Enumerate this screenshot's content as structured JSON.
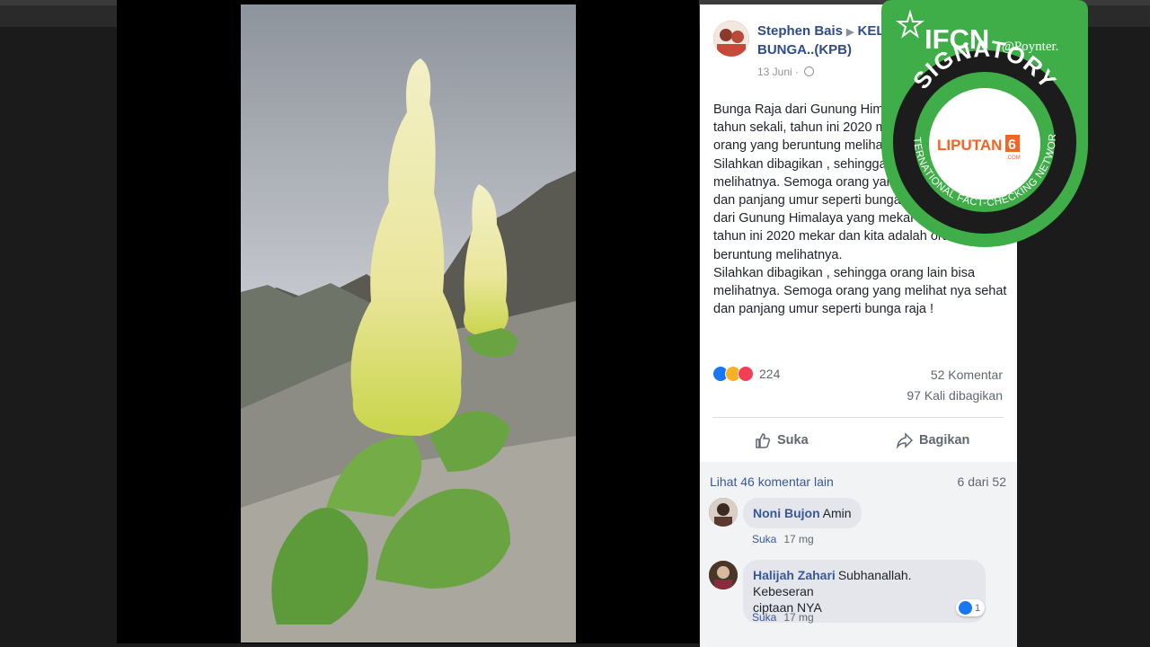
{
  "post": {
    "author": "Stephen Bais",
    "group": "KELA",
    "group_line2": "BUNGA..(KPB)",
    "date": "13 Juni",
    "text_lines": [
      "Bunga Raja dari Gunung Himal",
      "tahun sekali, tahun ini 2020 me",
      "orang yang beruntung melihatn",
      "Silahkan dibagikan , sehingga o",
      "melihatnya. Semoga orang yang",
      "dan panjang umur seperti bunga",
      "dari Gunung Himalaya yang mekar 4",
      "tahun ini 2020 mekar dan kita adalah orang",
      "beruntung melihatnya.",
      "Silahkan dibagikan , sehingga orang lain bisa",
      "melihatnya. Semoga orang yang melihat nya sehat",
      "dan panjang umur seperti bunga raja !"
    ],
    "reaction_count": "224",
    "comments": "52 Komentar",
    "shares": "97 Kali dibagikan",
    "like_label": "Suka",
    "share_label": "Bagikan"
  },
  "comments": {
    "more_label": "Lihat 46 komentar lain",
    "page_label": "6 dari 52",
    "items": [
      {
        "name": "Noni Bujon",
        "text": "Amin",
        "like": "Suka",
        "time": "17 mg"
      },
      {
        "name": "Halijah Zahari",
        "text": "Subhanallah. Kebeseran",
        "text2": "ciptaan NYA",
        "like": "Suka",
        "time": "17 mg",
        "reactions": "1"
      }
    ]
  },
  "badge": {
    "brand": "IFCN",
    "by": "@Poynter.",
    "word": "SIGNATORY",
    "ring_text": "INTERNATIONAL FACT-CHECKING NETWORK",
    "logo_text": "LIPUTAN",
    "logo_num": "6",
    "logo_domain": ".COM",
    "color": "#3fae49"
  }
}
